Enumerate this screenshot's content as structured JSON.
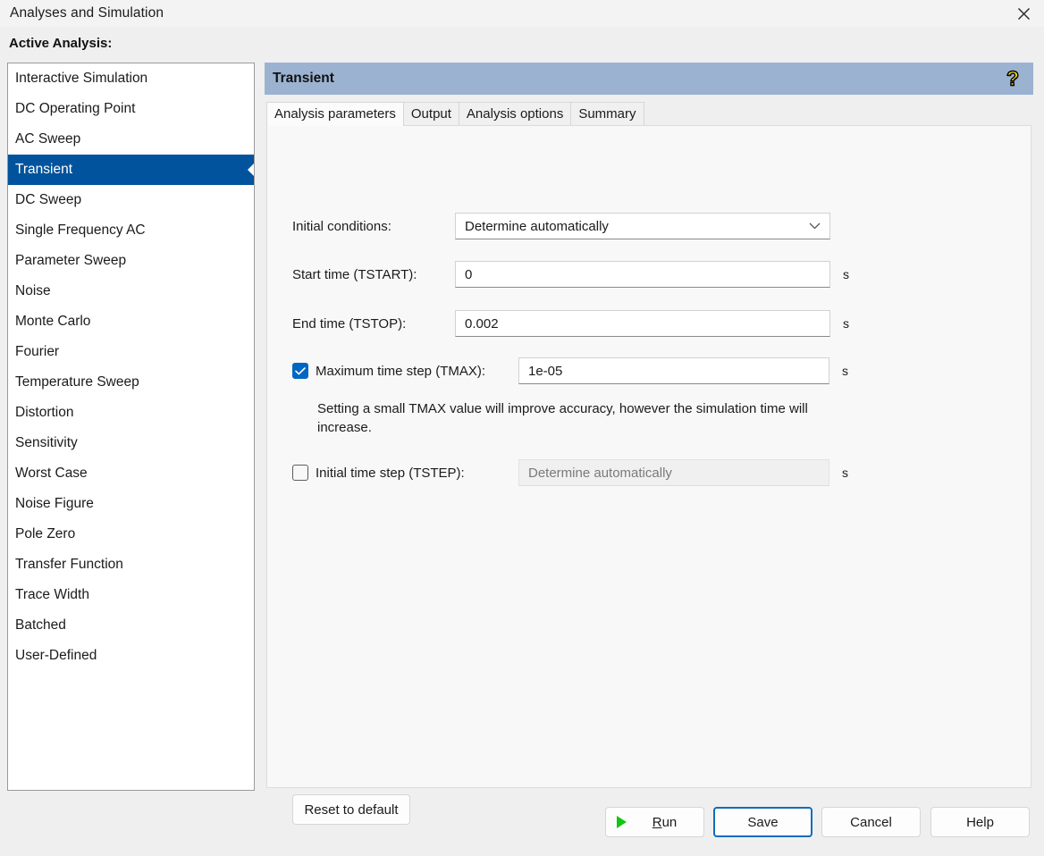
{
  "window": {
    "title": "Analyses and Simulation",
    "close_icon": "close-icon"
  },
  "active_analysis": {
    "label": "Active Analysis:",
    "selected": "Transient",
    "items": [
      "Interactive Simulation",
      "DC Operating Point",
      "AC Sweep",
      "Transient",
      "DC Sweep",
      "Single Frequency AC",
      "Parameter Sweep",
      "Noise",
      "Monte Carlo",
      "Fourier",
      "Temperature Sweep",
      "Distortion",
      "Sensitivity",
      "Worst Case",
      "Noise Figure",
      "Pole Zero",
      "Transfer Function",
      "Trace Width",
      "Batched",
      "User-Defined"
    ]
  },
  "panel": {
    "header_title": "Transient",
    "help_icon": "question-mark-icon",
    "help_glyph": "?",
    "tabs": [
      {
        "label": "Analysis parameters",
        "active": true
      },
      {
        "label": "Output",
        "active": false
      },
      {
        "label": "Analysis options",
        "active": false
      },
      {
        "label": "Summary",
        "active": false
      }
    ]
  },
  "form": {
    "initial_conditions": {
      "label": "Initial conditions:",
      "value": "Determine automatically",
      "chevron_icon": "chevron-down-icon"
    },
    "start_time": {
      "label": "Start time (TSTART):",
      "value": "0",
      "unit": "s"
    },
    "end_time": {
      "label": "End time (TSTOP):",
      "value": "0.002",
      "unit": "s"
    },
    "max_time_step": {
      "label": "Maximum time step (TMAX):",
      "value": "1e-05",
      "unit": "s",
      "checked": true,
      "check_icon": "checkmark-icon"
    },
    "hint": "Setting a small TMAX value will improve accuracy, however the simulation time will increase.",
    "initial_time_step": {
      "label": "Initial time step (TSTEP):",
      "value": "",
      "placeholder": "Determine automatically",
      "unit": "s",
      "checked": false
    },
    "reset_button": "Reset to default"
  },
  "footer": {
    "run": {
      "label": "Run",
      "accel": "R",
      "rest": "un",
      "icon": "play-icon"
    },
    "save": "Save",
    "cancel": "Cancel",
    "help": "Help"
  },
  "colors": {
    "selection_blue": "#00539c",
    "header_blue": "#9bb3d1",
    "accent_checkbox": "#0067c0",
    "focus_border": "#0f6cbd",
    "play_green": "#13c613",
    "help_yellow": "#ffe400"
  }
}
